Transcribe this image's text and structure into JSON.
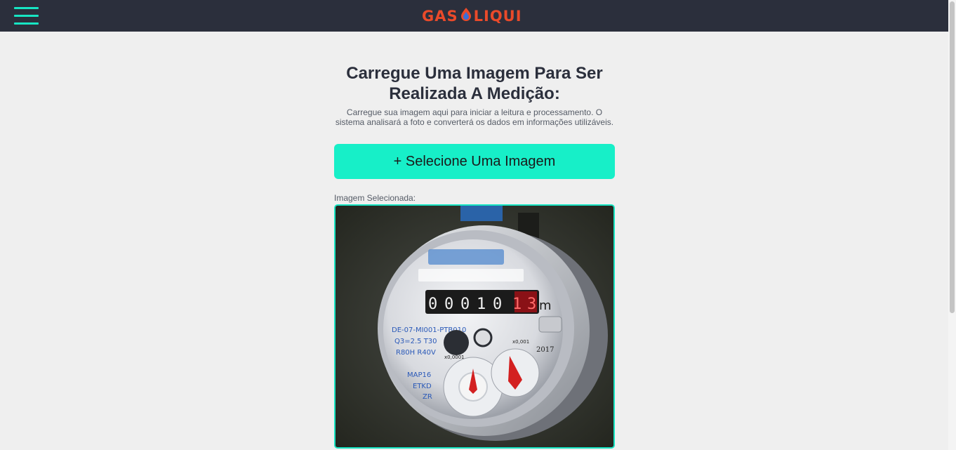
{
  "header": {
    "logo_left": "GAS",
    "logo_right": "LIQUI",
    "colors": {
      "background": "#2b2f3c",
      "accent": "#17e5c3",
      "logo": "#ea4a2a"
    }
  },
  "main": {
    "title": "Carregue Uma Imagem Para Ser Realizada A Medição:",
    "description": "Carregue sua imagem aqui para iniciar a leitura e processamento. O sistema analisará a foto e converterá os dados em informações utilizáveis.",
    "select_button": "+ Selecione Uma Imagem",
    "selected_label": "Imagem Selecionada:",
    "meter": {
      "digits": [
        "0",
        "0",
        "0",
        "1",
        "0",
        "1",
        "3"
      ],
      "unit": "m",
      "lines": [
        "DE-07-MI001-PTB010",
        "Q3=2.5  T30",
        "R80H R40V",
        "MAP16",
        "ETKD",
        "ZR"
      ],
      "year": "2017",
      "dial_label_left": "x0,0001",
      "dial_label_right": "x0,001"
    }
  }
}
